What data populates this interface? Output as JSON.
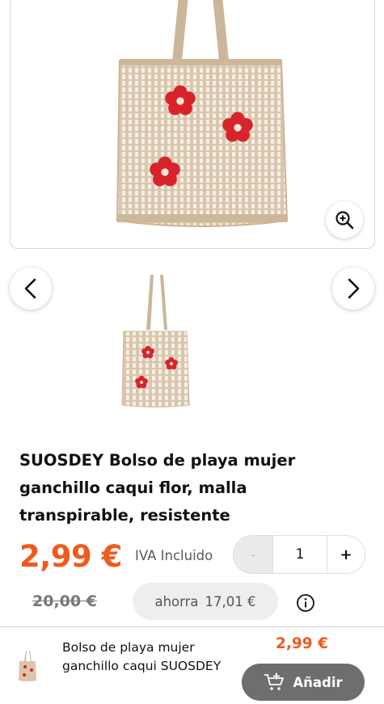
{
  "product": {
    "title": "SUOSDEY Bolso de playa mujer ganchillo caqui flor, malla transpirable, resistente",
    "price": "2,99 €",
    "tax_note": "IVA Incluido",
    "old_price": "20,00 €",
    "savings_label": "ahorra",
    "savings_amount": "17,01 €"
  },
  "quantity": {
    "minus_label": "-",
    "value": "1",
    "plus_label": "+"
  },
  "sticky_bar": {
    "title": "Bolso de playa mujer ganchillo caqui SUOSDEY",
    "price": "2,99 €",
    "add_label": "Añadir"
  },
  "icons": {
    "zoom": "zoom-in-icon",
    "prev": "chevron-left-icon",
    "next": "chevron-right-icon",
    "info": "info-icon",
    "cart": "cart-add-icon"
  },
  "colors": {
    "accent": "#f05a1c",
    "bag": "#d7c2a8",
    "flower": "#d8232a",
    "add_button": "#6e6e6e"
  }
}
